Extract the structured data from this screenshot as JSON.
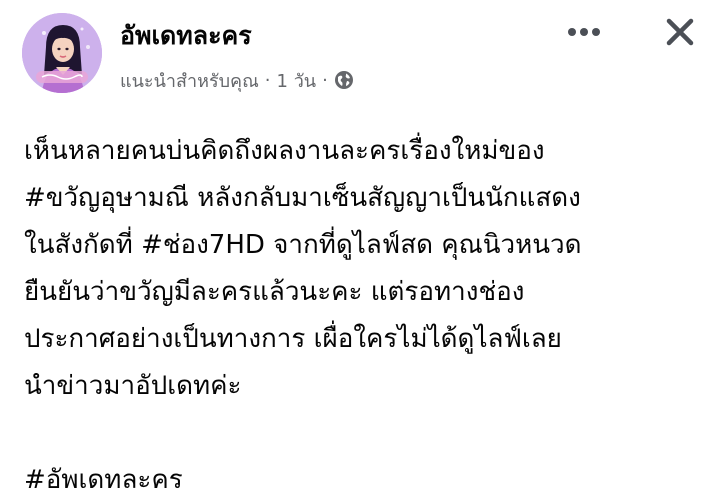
{
  "post": {
    "page_name": "อัพเดทละคร",
    "subtitle": "แนะนำสำหรับคุณ",
    "separator": "·",
    "time": "1 วัน",
    "icons": {
      "more": "more-horizontal-icon",
      "close": "close-icon",
      "audience": "globe-icon"
    },
    "body_lines": [
      "เห็นหลายคนบ่นคิดถึงผลงานละครเรื่องใหม่ของ",
      "#ขวัญอุษามณี หลังกลับมาเซ็นสัญญาเป็นนักแสดง",
      "ในสังกัดที่ #ช่อง7HD จากที่ดูไลฟ์สด คุณนิวหนวด",
      "ยืนยันว่าขวัญมีละครแล้วนะคะ แต่รอทางช่อง",
      "ประกาศอย่างเป็นทางการ เผื่อใครไม่ได้ดูไลฟ์เลย",
      "นำข่าวมาอัปเดทค่ะ"
    ],
    "hashtag": "#อัพเดทละคร"
  },
  "colors": {
    "text_primary": "#050505",
    "text_secondary": "#65676b",
    "icon": "#4b4f56",
    "avatar_bg": "#c9a7e8"
  }
}
